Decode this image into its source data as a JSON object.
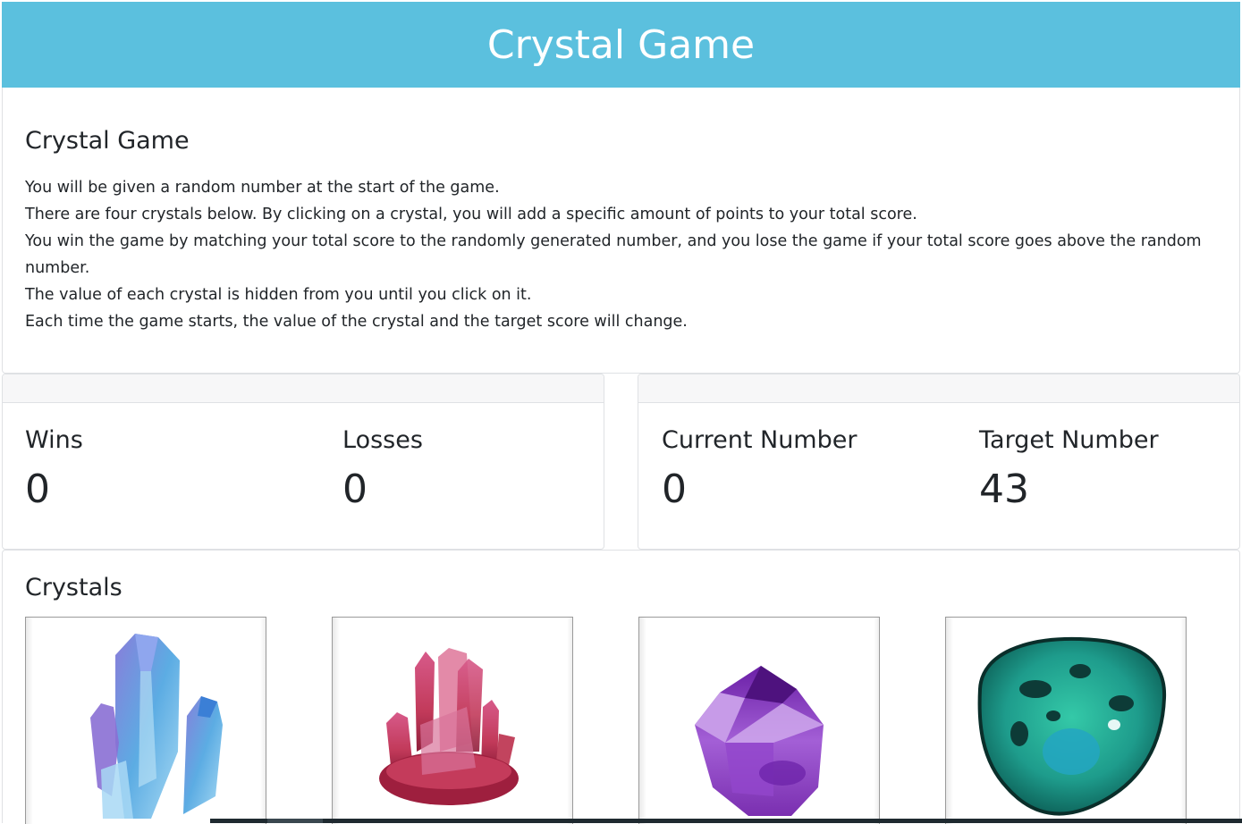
{
  "header": {
    "title": "Crystal Game"
  },
  "intro": {
    "heading": "Crystal Game",
    "lines": [
      "You will be given a random number at the start of the game.",
      "There are four crystals below. By clicking on a crystal, you will add a specific amount of points to your total score.",
      "You win the game by matching your total score to the randomly generated number, and you lose the game if your total score goes above the random number.",
      "The value of each crystal is hidden from you until you click on it.",
      "Each time the game starts, the value of the crystal and the target score will change."
    ]
  },
  "scoreboard": {
    "wins_label": "Wins",
    "wins_value": "0",
    "losses_label": "Losses",
    "losses_value": "0",
    "current_label": "Current Number",
    "current_value": "0",
    "target_label": "Target Number",
    "target_value": "43"
  },
  "crystals": {
    "heading": "Crystals",
    "items": [
      {
        "icon": "blue-quartz-crystal-icon",
        "color": "#5b8fd8"
      },
      {
        "icon": "red-quartz-cluster-icon",
        "color": "#b8324f"
      },
      {
        "icon": "amethyst-point-icon",
        "color": "#8a3fc2"
      },
      {
        "icon": "green-malachite-stone-icon",
        "color": "#1e9c8c"
      }
    ]
  },
  "colors": {
    "header_bg": "#5bc0de",
    "header_text": "#ffffff"
  }
}
